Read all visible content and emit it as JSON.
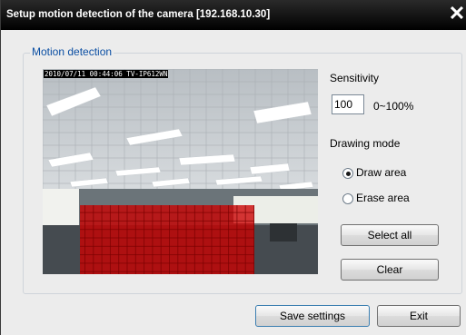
{
  "window": {
    "title": "Setup motion detection of the camera [192.168.10.30]",
    "close_glyph": "✕"
  },
  "group": {
    "label": "Motion detection"
  },
  "preview": {
    "osd": "2010/07/11 00:44:06 TV-IP612WN",
    "detection_area_color": "#cc0000"
  },
  "sensitivity": {
    "label": "Sensitivity",
    "value": "100",
    "range": "0~100%"
  },
  "drawing_mode": {
    "label": "Drawing mode",
    "options": [
      {
        "label": "Draw area",
        "checked": true
      },
      {
        "label": "Erase area",
        "checked": false
      }
    ]
  },
  "buttons": {
    "select_all": "Select all",
    "clear": "Clear",
    "save_settings": "Save settings",
    "exit": "Exit"
  }
}
